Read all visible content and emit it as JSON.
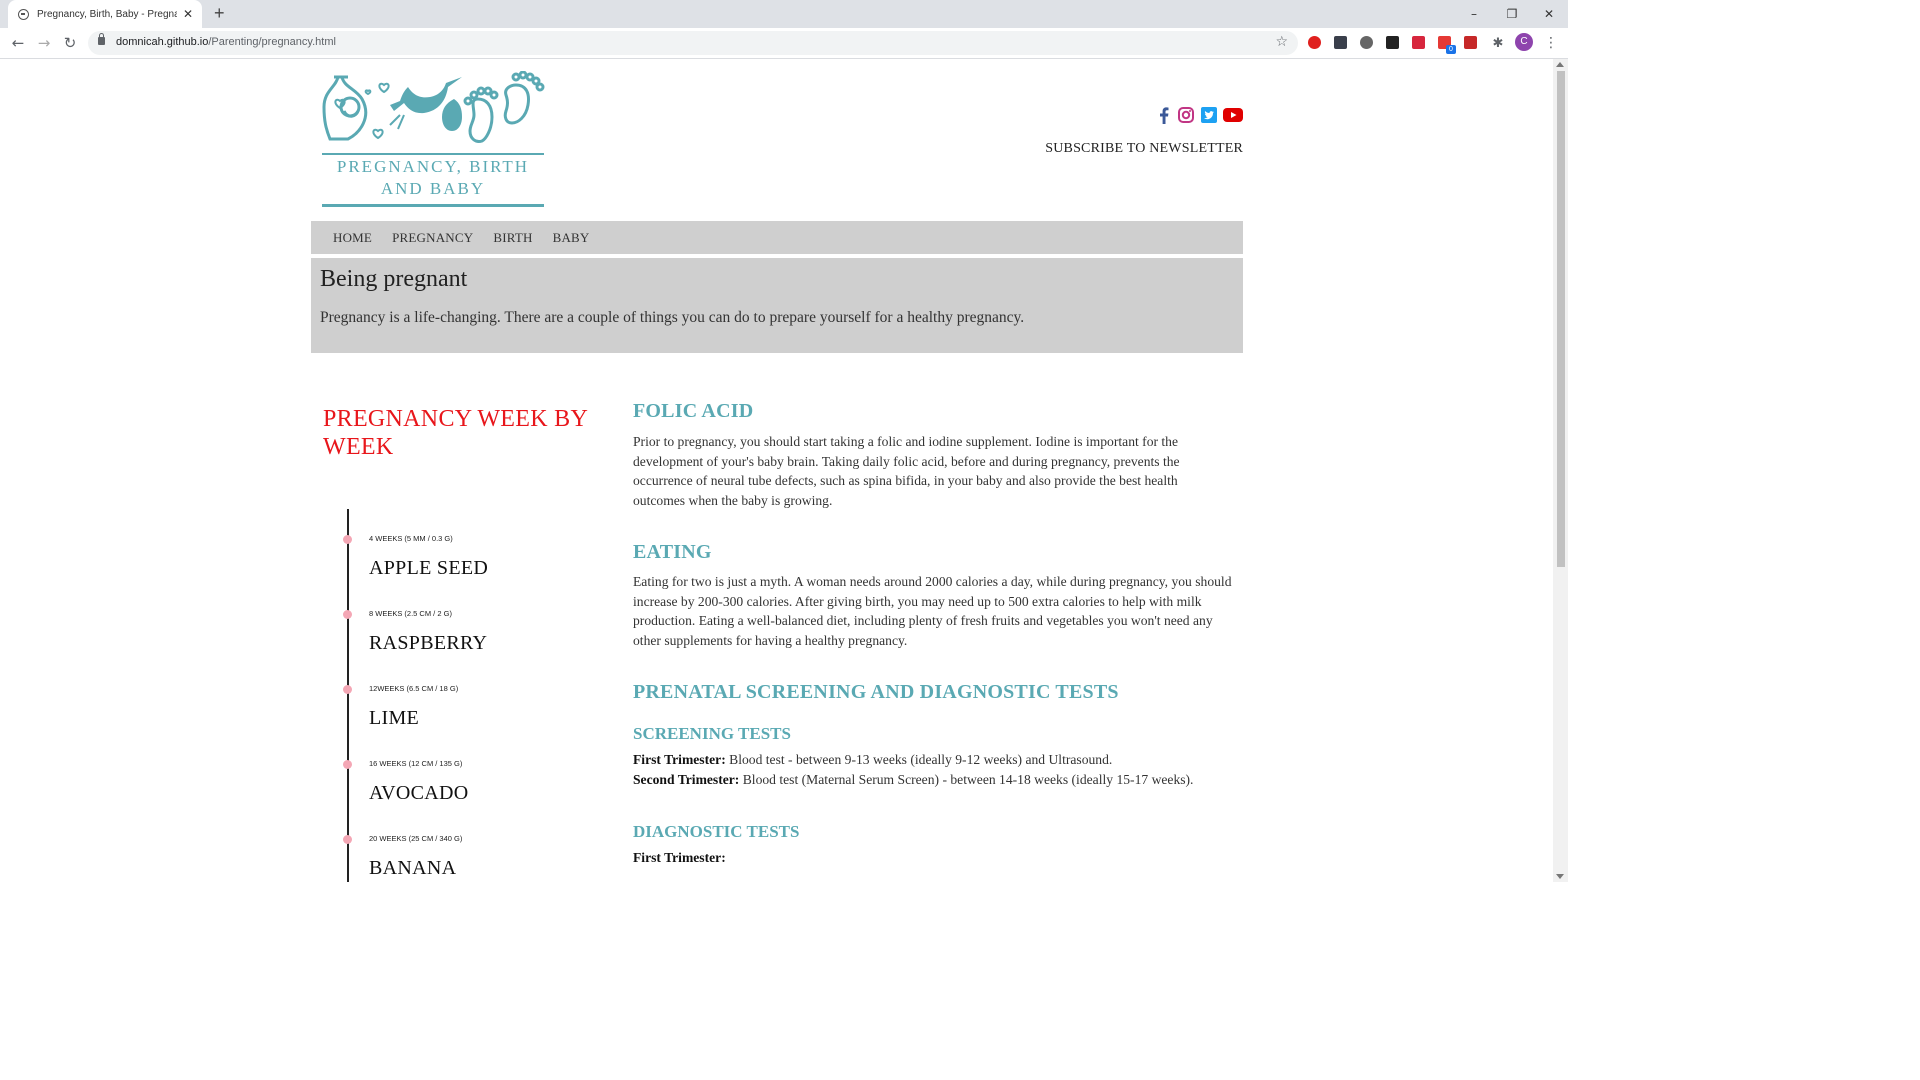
{
  "browser": {
    "tab_title": "Pregnancy, Birth, Baby - Pregnancy",
    "url_host": "domnicah.github.io",
    "url_path": "/Parenting/pregnancy.html",
    "new_tab_symbol": "+",
    "tab_close_symbol": "✕",
    "window_controls": {
      "minimize": "–",
      "restore": "❐",
      "close": "✕"
    },
    "profile_initial": "C",
    "extension_badge": "0"
  },
  "site": {
    "logo_text_line1": "PREGNANCY, BIRTH",
    "logo_text_line2": "AND BABY",
    "brand_color": "#5aa9b3",
    "subscribe_label": "SUBSCRIBE TO NEWSLETTER",
    "social": [
      {
        "name": "facebook",
        "color": "#3b5998"
      },
      {
        "name": "instagram",
        "color": "#c13584"
      },
      {
        "name": "twitter",
        "color": "#1da1f2"
      },
      {
        "name": "youtube",
        "color": "#e00000"
      }
    ]
  },
  "nav": {
    "items": [
      "HOME",
      "PREGNANCY",
      "BIRTH",
      "BABY"
    ],
    "background": "#cfcfcf"
  },
  "hero": {
    "title": "Being pregnant",
    "text": "Pregnancy is a life-changing. There are a couple of things you can do to prepare yourself for a healthy pregnancy."
  },
  "timeline": {
    "title": "PREGNANCY WEEK BY WEEK",
    "title_color": "#e8161b",
    "dot_color": "#f4a7b5",
    "items": [
      {
        "meta": "4 WEEKS (5 MM / 0.3 G)",
        "fruit": "APPLE SEED"
      },
      {
        "meta": "8 WEEKS (2.5 CM / 2 G)",
        "fruit": "RASPBERRY"
      },
      {
        "meta": "12WEEKS (6.5 CM / 18 G)",
        "fruit": "LIME"
      },
      {
        "meta": "16 WEEKS (12 CM / 135 G)",
        "fruit": "AVOCADO"
      },
      {
        "meta": "20 WEEKS (25 CM / 340 G)",
        "fruit": "BANANA"
      }
    ]
  },
  "content": {
    "folic": {
      "heading": "FOLIC ACID",
      "text": "Prior to pregnancy, you should start taking a folic and iodine supplement. Iodine is important for the development of your's baby brain. Taking daily folic acid, before and during pregnancy, prevents the occurrence of neural tube defects, such as spina bifida, in your baby and also provide the best health outcomes when the baby is growing."
    },
    "eating": {
      "heading": "EATING",
      "text": "Eating for two is just a myth. A woman needs around 2000 calories a day, while during pregnancy, you should increase by 200-300 calories. After giving birth, you may need up to 500 extra calories to help with milk production. Eating a well-balanced diet, including plenty of fresh fruits and vegetables you won't need any other supplements for having a healthy pregnancy."
    },
    "prenatal": {
      "heading": "PRENATAL SCREENING AND DIAGNOSTIC TESTS",
      "screening_heading": "SCREENING TESTS",
      "first_label": "First Trimester:",
      "first_text": " Blood test - between 9-13 weeks (ideally 9-12 weeks) and Ultrasound.",
      "second_label": "Second Trimester:",
      "second_text": " Blood test (Maternal Serum Screen) - between 14-18 weeks (ideally 15-17 weeks).",
      "diagnostic_heading": "DIAGNOSTIC TESTS",
      "diag_first_label": "First Trimester:"
    }
  }
}
